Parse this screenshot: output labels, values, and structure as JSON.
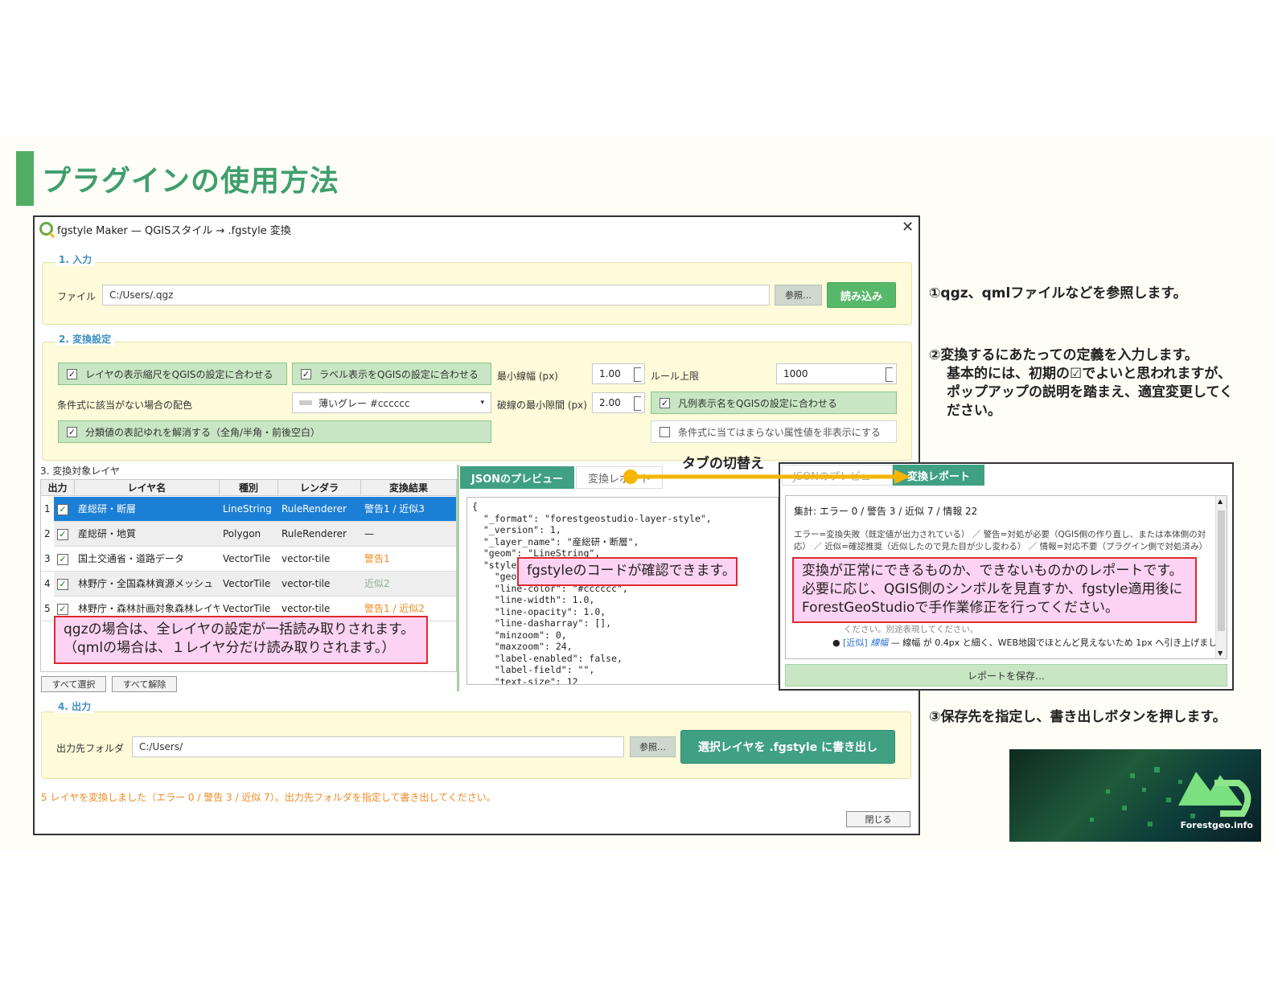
{
  "slide": {
    "title": "プラグインの使用方法",
    "colors": {
      "accent": "#4fae63",
      "title": "#3f9e6e",
      "callout_bg": "#fcd3f2",
      "callout_border": "#e0282e",
      "arrow": "#f7b500"
    }
  },
  "window": {
    "title": "fgstyle Maker — QGISスタイル → .fgstyle 変換",
    "close_icon": "close-icon",
    "input_group": {
      "label": "1. 入力",
      "file_label": "ファイル",
      "file_value": "C:/Users/.qgz",
      "browse_label": "参照…",
      "load_label": "読み込み"
    },
    "settings_group": {
      "label": "2. 変換設定",
      "chk_scale": "レイヤの表示縮尺をQGISの設定に合わせる",
      "chk_label": "ラベル表示をQGISの設定に合わせる",
      "min_line_label": "最小線幅 (px)",
      "min_line_value": "1.00",
      "rule_limit_label": "ルール上限",
      "rule_limit_value": "1000",
      "fallback_label": "条件式に該当がない場合の配色",
      "fallback_value": "薄いグレー #cccccc",
      "dash_gap_label": "破線の最小隙間 (px)",
      "dash_gap_value": "2.00",
      "chk_legend": "凡例表示名をQGISの設定に合わせる",
      "chk_normalize": "分類値の表記ゆれを解消する（全角/半角・前後空白）",
      "chk_hide": "条件式に当てはまらない属性値を非表示にする"
    },
    "layers_group": {
      "label": "3. 変換対象レイヤ",
      "columns": [
        "出力",
        "レイヤ名",
        "種別",
        "レンダラ",
        "変換結果"
      ],
      "rows": [
        {
          "num": "1",
          "name": "産総研・断層",
          "type": "LineString",
          "renderer": "RuleRenderer",
          "result": "警告1 / 近似3"
        },
        {
          "num": "2",
          "name": "産総研・地質",
          "type": "Polygon",
          "renderer": "RuleRenderer",
          "result": "—"
        },
        {
          "num": "3",
          "name": "国土交通省・道路データ",
          "type": "VectorTile",
          "renderer": "vector-tile",
          "result": "警告1"
        },
        {
          "num": "4",
          "name": "林野庁・全国森林資源メッシュ",
          "type": "VectorTile",
          "renderer": "vector-tile",
          "result": "近似2"
        },
        {
          "num": "5",
          "name": "林野庁・森林計画対象森林レイヤ",
          "type": "VectorTile",
          "renderer": "vector-tile",
          "result": "警告1 / 近似2"
        }
      ],
      "select_all": "すべて選択",
      "deselect_all": "すべて解除"
    },
    "preview": {
      "tab_json": "JSONのプレビュー",
      "tab_report": "変換レポート",
      "code_lines": [
        "{",
        "  \"_format\": \"forestgeostudio-layer-style\",",
        "  \"_version\": 1,",
        "  \"_layer_name\": \"産総研・断層\",",
        "  \"geom\": \"LineString\",",
        "  \"style\": {",
        "    \"geo",
        "    \"line-color\": \"#cccccc\",",
        "    \"line-width\": 1.0,",
        "    \"line-opacity\": 1.0,",
        "    \"line-dasharray\": [],",
        "    \"minzoom\": 0,",
        "    \"maxzoom\": 24,",
        "    \"label-enabled\": false,",
        "    \"label-field\": \"\",",
        "    \"text-size\": 12"
      ]
    },
    "output_group": {
      "label": "4. 出力",
      "folder_label": "出力先フォルダ",
      "folder_value": "C:/Users/",
      "browse_label": "参照…",
      "export_label": "選択レイヤを .fgstyle に書き出し"
    },
    "status": "5 レイヤを変換しました（エラー 0 / 警告 3 / 近似 7）。出力先フォルダを指定して書き出してください。",
    "close_label": "閉じる"
  },
  "report_panel": {
    "tab_json": "JSONのプレビュー",
    "tab_report": "変換レポート",
    "summary": "集計: エラー 0 / 警告 3 / 近似 7 / 情報 22",
    "legend_line1": "エラー=変換失敗（既定値が出力されている） ／ 警告=対処が必要（QGIS側の作り直し、または本体側の対",
    "legend_line2": "応） ／ 近似=確認推奨（近似したので見た目が少し変わる） ／ 情報=対応不要（プラグイン側で対処済み）",
    "hidden_line": "ください。別途表現してください。",
    "item_tag": "[近似]",
    "item_field": "線幅",
    "item_text": "— 線幅 が 0.4px と細く、WEB地図でほとんど見えないため 1px へ引き上げまし",
    "save_label": "レポートを保存…"
  },
  "annotations": {
    "tab_switch": "タブの切替え",
    "note1": "①qgz、qmlファイルなどを参照します。",
    "note2_line1": "②変換するにあたっての定義を入力します。",
    "note2_line2": "基本的には、初期の☑でよいと思われますが、",
    "note2_line3": "ポップアップの説明を踏まえ、適宜変更してく",
    "note2_line4": "ださい。",
    "note3": "③保存先を指定し、書き出しボタンを押します。",
    "callout_qgz_line1": "qgzの場合は、全レイヤの設定が一括読み取りされます。",
    "callout_qgz_line2": "（qmlの場合は、１レイヤ分だけ読み取りされます。）",
    "callout_code": "fgstyleのコードが確認できます。",
    "callout_report_line1": "変換が正常にできるものか、できないものかのレポートです。",
    "callout_report_line2": "必要に応じ、QGIS側のシンボルを見直すか、fgstyle適用後に",
    "callout_report_line3": "ForestGeoStudioで手作業修正を行ってください。"
  },
  "logo": {
    "text": "Forestgeo.info"
  }
}
